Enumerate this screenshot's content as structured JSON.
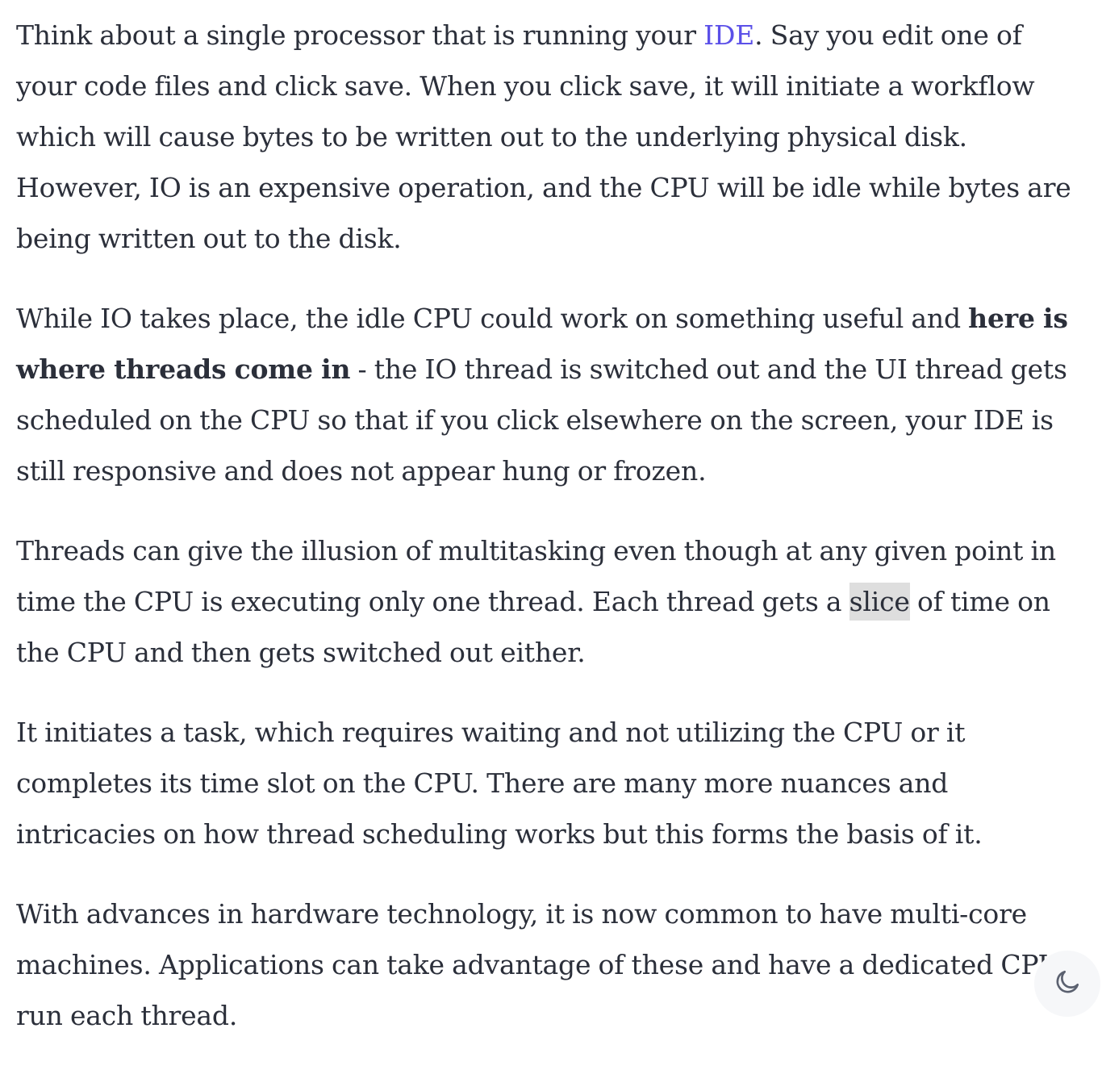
{
  "article": {
    "p1": {
      "before_link": "Think about a single processor that is running your ",
      "link": "IDE",
      "after_link": ". Say you edit one of your code files and click save. When you click save, it will initiate a workflow which will cause bytes to be written out to the underlying physical disk. However, IO is an expensive operation, and the CPU will be idle while bytes are being written out to the disk."
    },
    "p2": {
      "before_bold": "While IO takes place, the idle CPU could work on something useful and ",
      "bold": "here is where threads come in",
      "after_bold": " - the IO thread is switched out and the UI thread gets scheduled on the CPU so that if you click elsewhere on the screen, your IDE is still responsive and does not appear hung or frozen."
    },
    "p3": {
      "before_highlight": "Threads can give the illusion of multitasking even though at any given point in time the CPU is executing only one thread. Each thread gets a ",
      "highlight": "slice",
      "after_highlight": " of time on the CPU and then gets switched out either."
    },
    "p4": {
      "text": "It initiates a task, which requires waiting and not utilizing the CPU or it completes its time slot on the CPU. There are many more nuances and intricacies on how thread scheduling works but this forms the basis of it."
    },
    "p5": {
      "text": "With advances in hardware technology, it is now common to have multi-core machines. Applications can take advantage of these and have a dedicated CPU run each thread."
    }
  },
  "theme_toggle": {
    "icon": "moon-icon"
  },
  "colors": {
    "text": "#2b2f3a",
    "link": "#5b50e8",
    "highlight": "#dedede",
    "toggle_bg": "#f6f7f9"
  }
}
